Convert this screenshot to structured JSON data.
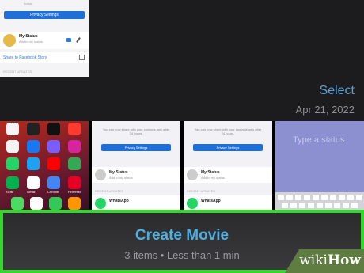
{
  "top": {
    "privacy_button": "Privacy Settings",
    "my_status_title": "My Status",
    "my_status_sub": "Add to my status",
    "share_label": "Share to Facebook Story",
    "recent_updates": "RECENT UPDATES",
    "hours_fragment": "hours.",
    "select_label": "Select",
    "date_label": "Apr 21, 2022"
  },
  "thumbs": {
    "wa1": {
      "desc": "You can now share with your contacts only after 24 hours.",
      "privacy_button": "Privacy Settings",
      "my_status_title": "My Status",
      "my_status_sub": "Add to my status",
      "recent": "RECENT UPDATES",
      "contact_name": "WhatsApp"
    },
    "wa2": {
      "desc": "You can now share with your contacts only after 24 hours.",
      "privacy_button": "Privacy Settings",
      "my_status_title": "My Status",
      "my_status_sub": "Add to my status",
      "recent": "RECENT UPDATES",
      "contact_name": "WhatsApp"
    },
    "type_status_placeholder": "Type a status",
    "home_labels": [
      "Grab",
      "Gmail",
      "Chrome",
      "Pinterest"
    ]
  },
  "banner": {
    "title": "Create Movie",
    "subtitle": "3 items • Less than 1 min"
  },
  "watermark": {
    "wiki": "wiki",
    "how": "How"
  },
  "colors": {
    "accent_blue": "#5a9fd6",
    "highlight_green": "#38d430",
    "whatsapp_green": "#25d366"
  }
}
